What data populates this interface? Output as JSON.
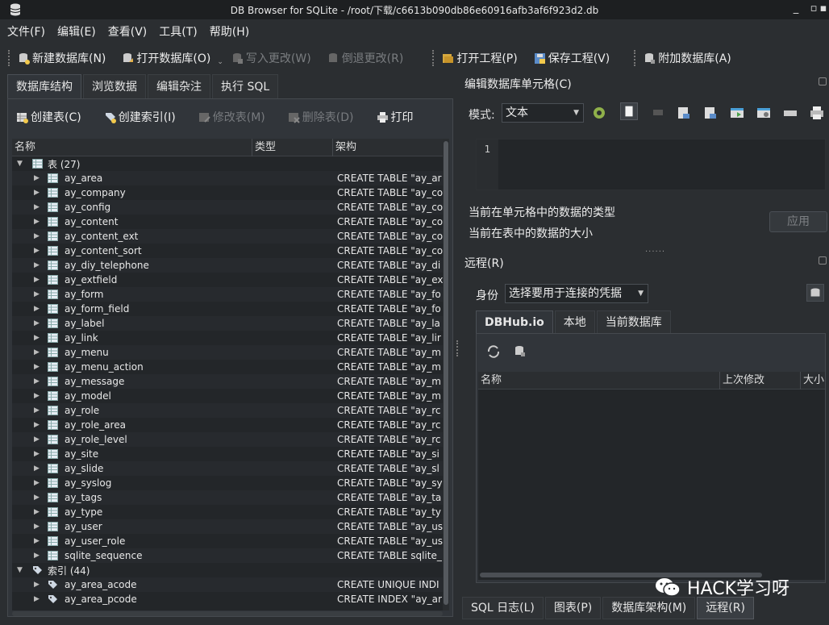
{
  "window": {
    "title": "DB Browser for SQLite - /root/下载/c6613b090db86e60916afb3af6f923d2.db"
  },
  "menu": [
    "文件(F)",
    "编辑(E)",
    "查看(V)",
    "工具(T)",
    "帮助(H)"
  ],
  "toolbar": {
    "new_db": "新建数据库(N)",
    "open_db": "打开数据库(O)",
    "write_changes": "写入更改(W)",
    "revert_changes": "倒退更改(R)",
    "open_project": "打开工程(P)",
    "save_project": "保存工程(V)",
    "attach_db": "附加数据库(A)"
  },
  "main_tabs": [
    "数据库结构",
    "浏览数据",
    "编辑杂注",
    "执行 SQL"
  ],
  "structure_toolbar": {
    "create_table": "创建表(C)",
    "create_index": "创建索引(I)",
    "modify_table": "修改表(M)",
    "delete_table": "删除表(D)",
    "print": "打印"
  },
  "tree": {
    "columns": [
      "名称",
      "类型",
      "架构"
    ],
    "tables_group": "表 (27)",
    "tables": [
      {
        "name": "ay_area",
        "schema": "CREATE TABLE \"ay_ar"
      },
      {
        "name": "ay_company",
        "schema": "CREATE TABLE \"ay_co"
      },
      {
        "name": "ay_config",
        "schema": "CREATE TABLE \"ay_co"
      },
      {
        "name": "ay_content",
        "schema": "CREATE TABLE \"ay_co"
      },
      {
        "name": "ay_content_ext",
        "schema": "CREATE TABLE \"ay_co"
      },
      {
        "name": "ay_content_sort",
        "schema": "CREATE TABLE \"ay_co"
      },
      {
        "name": "ay_diy_telephone",
        "schema": "CREATE TABLE \"ay_di"
      },
      {
        "name": "ay_extfield",
        "schema": "CREATE TABLE \"ay_ex"
      },
      {
        "name": "ay_form",
        "schema": "CREATE TABLE \"ay_fo"
      },
      {
        "name": "ay_form_field",
        "schema": "CREATE TABLE \"ay_fo"
      },
      {
        "name": "ay_label",
        "schema": "CREATE TABLE \"ay_la"
      },
      {
        "name": "ay_link",
        "schema": "CREATE TABLE \"ay_lir"
      },
      {
        "name": "ay_menu",
        "schema": "CREATE TABLE \"ay_m"
      },
      {
        "name": "ay_menu_action",
        "schema": "CREATE TABLE \"ay_m"
      },
      {
        "name": "ay_message",
        "schema": "CREATE TABLE \"ay_m"
      },
      {
        "name": "ay_model",
        "schema": "CREATE TABLE \"ay_m"
      },
      {
        "name": "ay_role",
        "schema": "CREATE TABLE \"ay_rc"
      },
      {
        "name": "ay_role_area",
        "schema": "CREATE TABLE \"ay_rc"
      },
      {
        "name": "ay_role_level",
        "schema": "CREATE TABLE \"ay_rc"
      },
      {
        "name": "ay_site",
        "schema": "CREATE TABLE \"ay_si"
      },
      {
        "name": "ay_slide",
        "schema": "CREATE TABLE \"ay_sl"
      },
      {
        "name": "ay_syslog",
        "schema": "CREATE TABLE \"ay_sy"
      },
      {
        "name": "ay_tags",
        "schema": "CREATE TABLE \"ay_ta"
      },
      {
        "name": "ay_type",
        "schema": "CREATE TABLE \"ay_ty"
      },
      {
        "name": "ay_user",
        "schema": "CREATE TABLE \"ay_us"
      },
      {
        "name": "ay_user_role",
        "schema": "CREATE TABLE \"ay_us"
      },
      {
        "name": "sqlite_sequence",
        "schema": "CREATE TABLE sqlite_"
      }
    ],
    "indexes_group": "索引 (44)",
    "indexes": [
      {
        "name": "ay_area_acode",
        "schema": "CREATE UNIQUE INDI"
      },
      {
        "name": "ay_area_pcode",
        "schema": "CREATE INDEX \"ay_ar"
      }
    ]
  },
  "edit_cell": {
    "title": "编辑数据库单元格(C)",
    "mode_label": "模式:",
    "mode_value": "文本",
    "line_number": "1",
    "type_text": "当前在单元格中的数据的类型",
    "size_text": "当前在表中的数据的大小",
    "apply": "应用"
  },
  "remote": {
    "title": "远程(R)",
    "identity_label": "身份",
    "identity_value": "选择要用于连接的凭据",
    "tabs": [
      "DBHub.io",
      "本地",
      "当前数据库"
    ],
    "columns": [
      "名称",
      "上次修改",
      "大小"
    ]
  },
  "bottom_tabs": [
    "SQL 日志(L)",
    "图表(P)",
    "数据库架构(M)",
    "远程(R)"
  ],
  "watermark": "HACK学习呀"
}
